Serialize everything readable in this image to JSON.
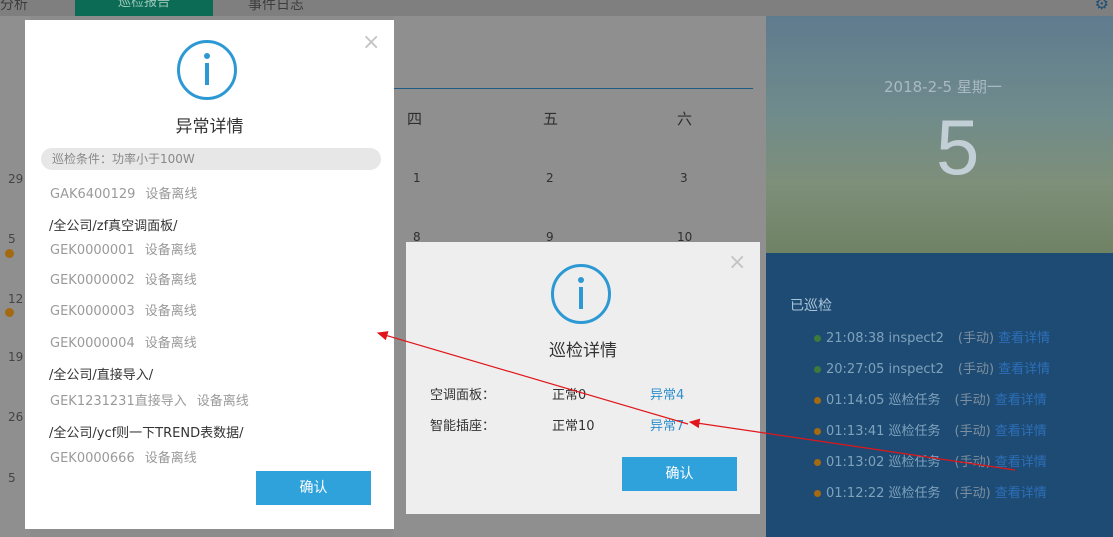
{
  "background": {
    "tabs": [
      "分析",
      "巡检报告",
      "事件日志"
    ],
    "left_dates": [
      "29",
      "5",
      "12",
      "19",
      "26",
      "5"
    ],
    "calendar_headers": [
      "四",
      "五",
      "六"
    ],
    "calendar_row1": [
      "1",
      "2",
      "3"
    ],
    "calendar_row2": [
      "8",
      "9",
      "10"
    ],
    "hero_date": "2018-2-5   星期一",
    "hero_day": "5",
    "panel_title": "已巡检",
    "records": [
      {
        "time": "21:08:38",
        "name": "inspect2",
        "mode": "(手动)",
        "link": "查看详情",
        "status_color": "#3d7a3a"
      },
      {
        "time": "20:27:05",
        "name": "inspect2",
        "mode": "(手动)",
        "link": "查看详情",
        "status_color": "#3d7a3a"
      },
      {
        "time": "01:14:05",
        "name": "巡检任务",
        "mode": "(手动)",
        "link": "查看详情",
        "status_color": "#a36a12"
      },
      {
        "time": "01:13:41",
        "name": "巡检任务",
        "mode": "(手动)",
        "link": "查看详情",
        "status_color": "#a36a12"
      },
      {
        "time": "01:13:02",
        "name": "巡检任务",
        "mode": "(手动)",
        "link": "查看详情",
        "status_color": "#a36a12"
      },
      {
        "time": "01:12:22",
        "name": "巡检任务",
        "mode": "(手动)",
        "link": "查看详情",
        "status_color": "#a36a12"
      }
    ]
  },
  "exception_dialog": {
    "title": "异常详情",
    "condition": "巡检条件：功率小于100W",
    "items": [
      {
        "type": "dev",
        "name": "GAK6400129",
        "status": "设备离线"
      },
      {
        "type": "grp",
        "name": "/全公司/zf真空调面板/"
      },
      {
        "type": "dev",
        "name": "GEK0000001",
        "status": "设备离线"
      },
      {
        "type": "dev",
        "name": "GEK0000002",
        "status": "设备离线"
      },
      {
        "type": "dev",
        "name": "GEK0000003",
        "status": "设备离线"
      },
      {
        "type": "dev",
        "name": "GEK0000004",
        "status": "设备离线"
      },
      {
        "type": "grp",
        "name": "/全公司/直接导入/"
      },
      {
        "type": "dev",
        "name": "GEK1231231直接导入",
        "status": "设备离线"
      },
      {
        "type": "grp",
        "name": "/全公司/ycf则一下TREND表数据/"
      },
      {
        "type": "dev",
        "name": "GEK0000666",
        "status": "设备离线"
      }
    ],
    "confirm_label": "确认",
    "close_glyph": "×"
  },
  "inspection_dialog": {
    "title": "巡检详情",
    "rows": [
      {
        "label": "空调面板：",
        "normal": "正常0",
        "abnormal": "异常4"
      },
      {
        "label": "智能插座：",
        "normal": "正常10",
        "abnormal": "异常7"
      }
    ],
    "confirm_label": "确认",
    "close_glyph": "×"
  },
  "colors": {
    "accent": "#2fa2db",
    "link": "#2f8fcf",
    "arrow": "#e0161a"
  }
}
